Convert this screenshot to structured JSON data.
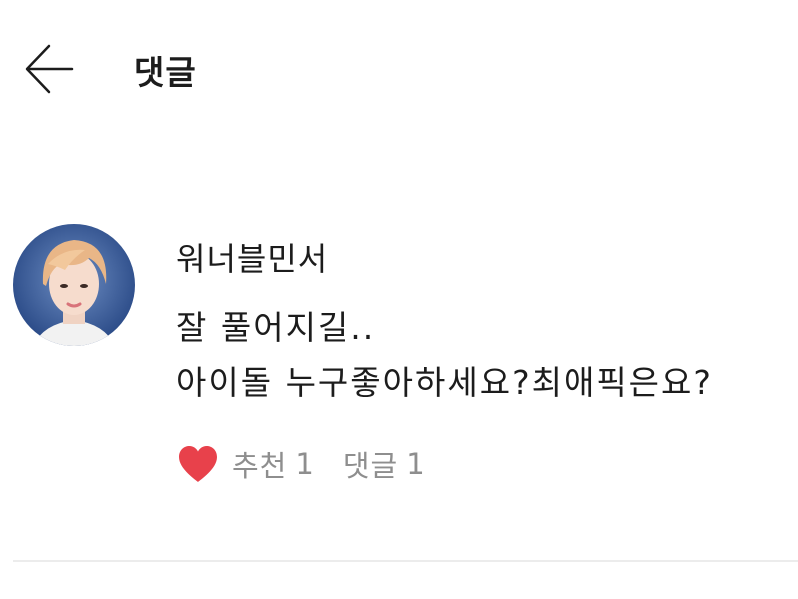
{
  "header": {
    "back_icon": "arrow-left-icon",
    "title": "댓글"
  },
  "comment": {
    "author": "워너블민서",
    "text_lines": [
      "잘 풀어지길..",
      "아이돌 누구좋아하세요?최애픽은요?"
    ],
    "like": {
      "icon": "heart-icon",
      "label": "추천",
      "count": "1",
      "color": "#e8414b"
    },
    "reply": {
      "label": "댓글",
      "count": "1"
    }
  },
  "colors": {
    "text": "#1c1c1c",
    "muted": "#8e8e8e",
    "divider": "#ececec"
  }
}
